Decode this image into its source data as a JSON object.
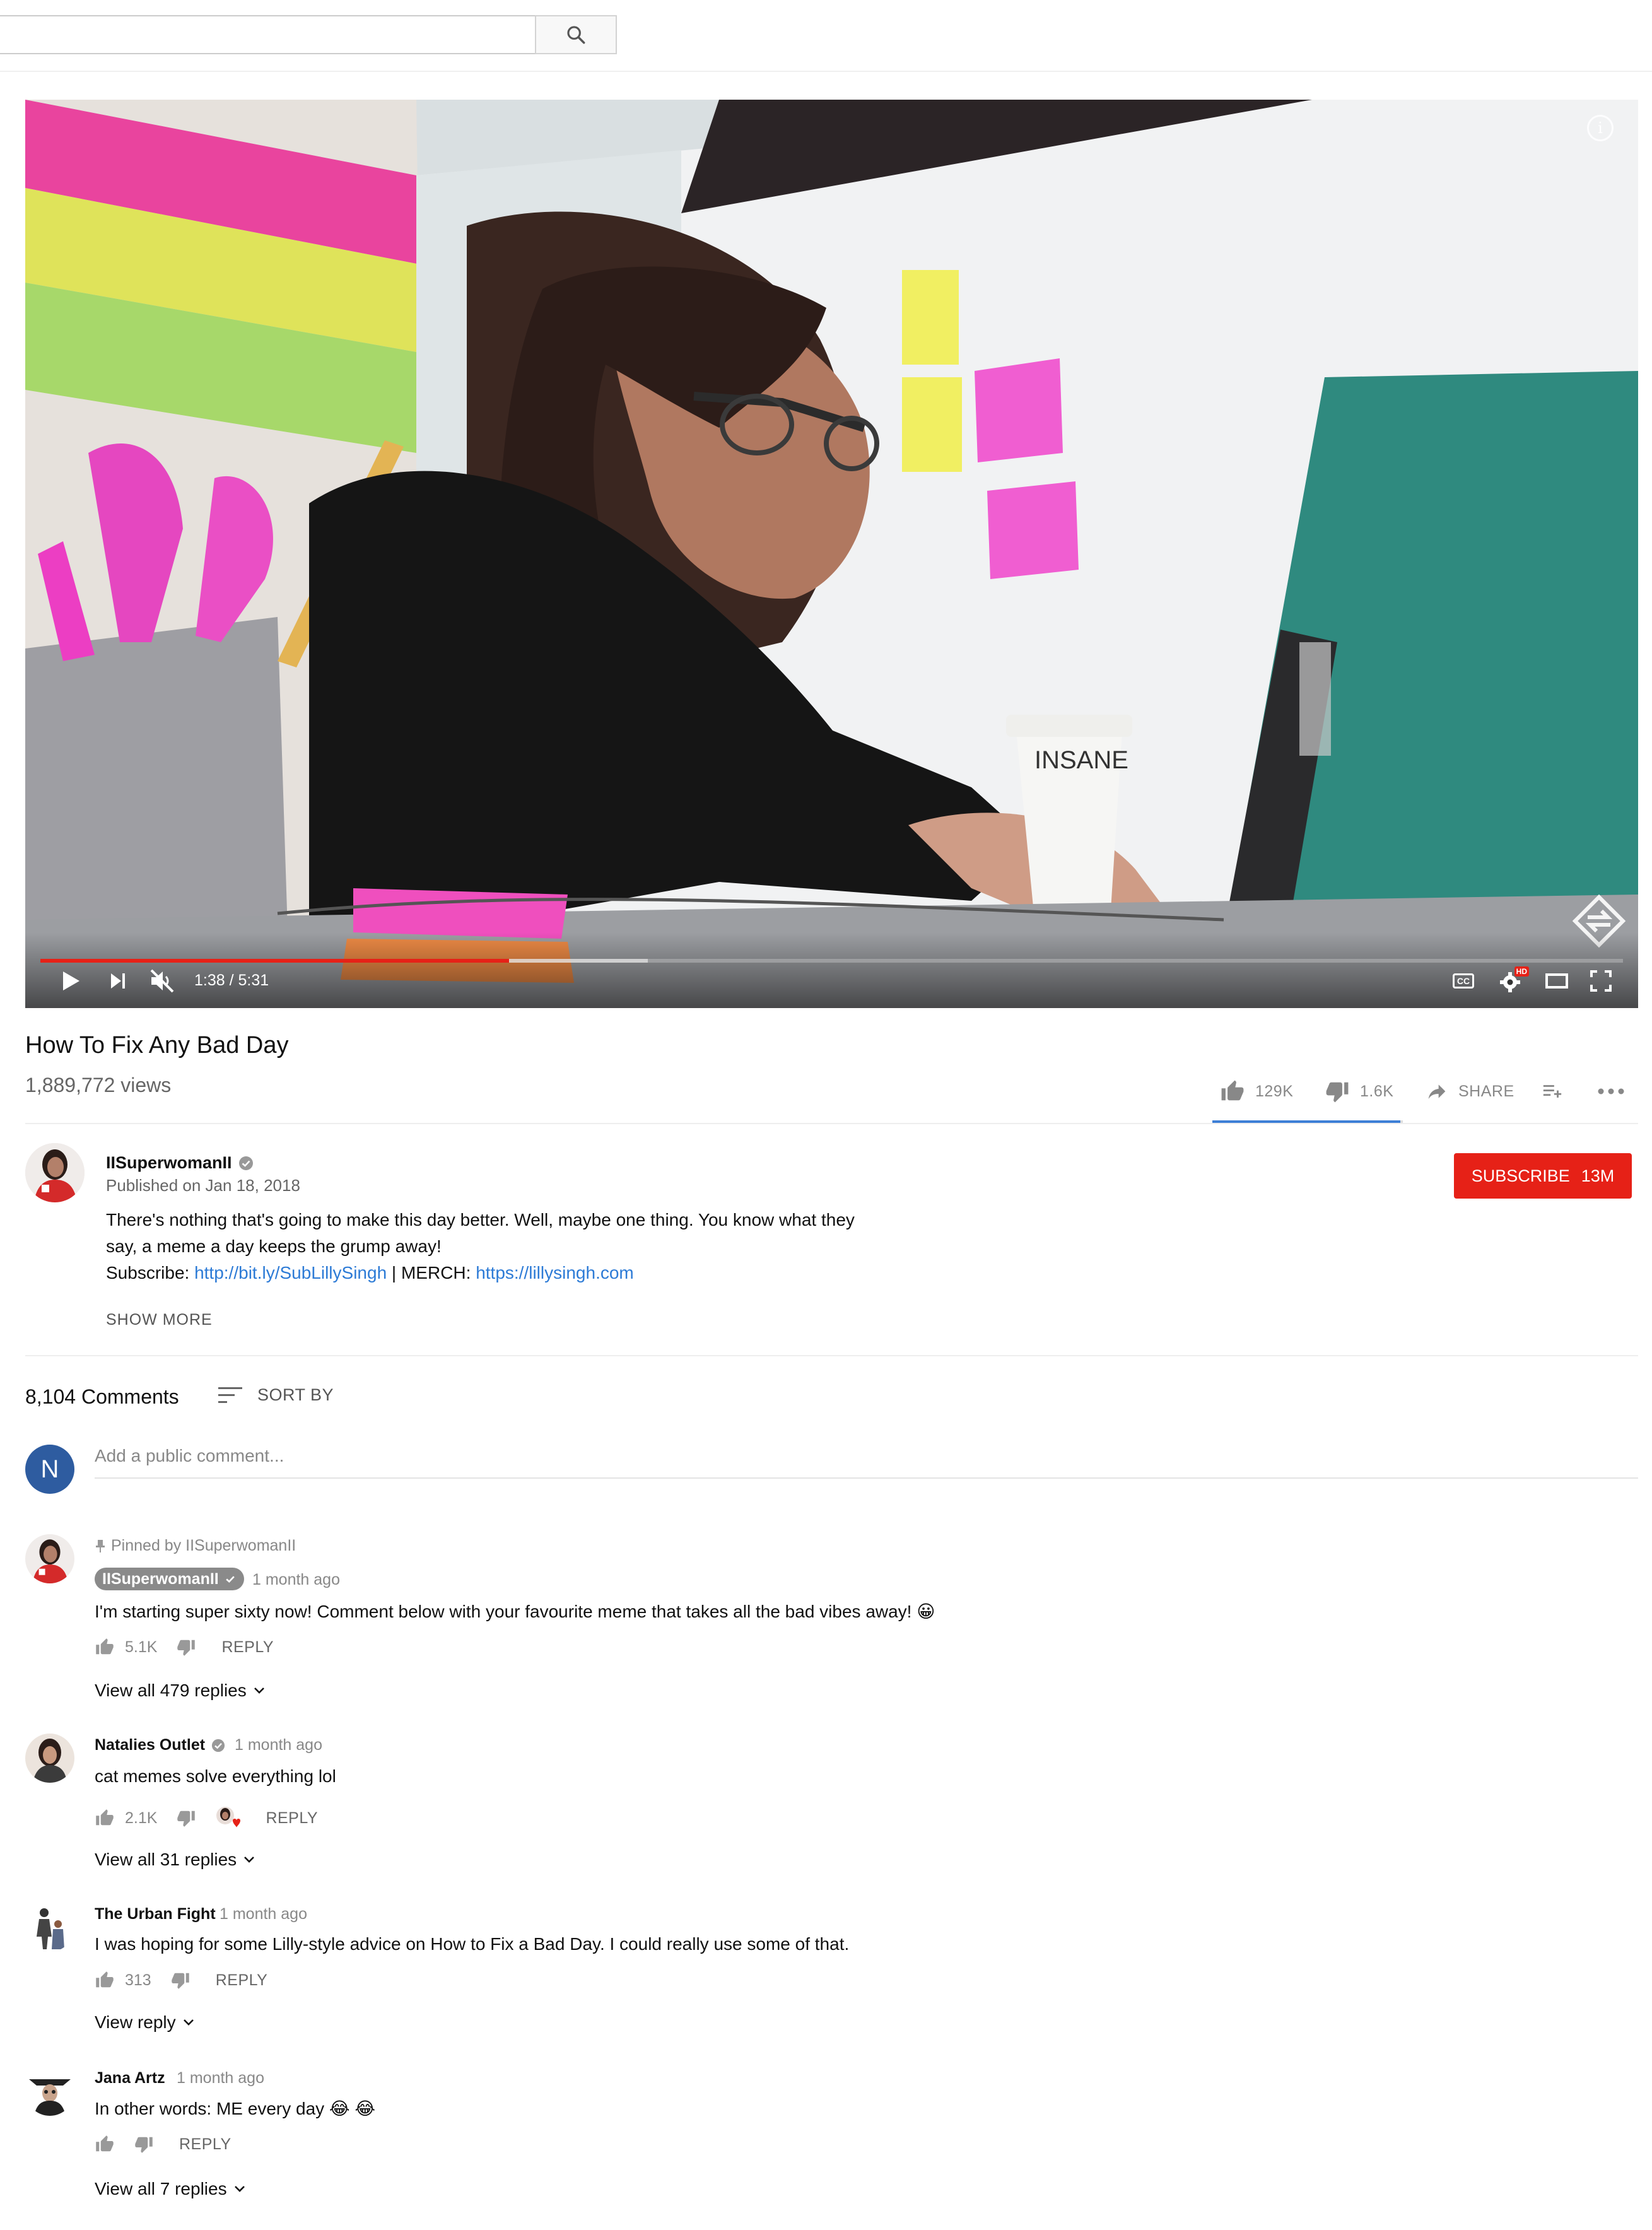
{
  "search": {
    "placeholder": "",
    "value": ""
  },
  "player": {
    "current_time": "1:38",
    "duration": "5:31",
    "time_display": "1:38 / 5:31",
    "progress_fraction": 0.296,
    "buffered_fraction": 0.384,
    "cup_label": "INSANE",
    "hd_badge": "HD",
    "cc_label": "CC"
  },
  "video": {
    "title": "How To Fix Any Bad Day",
    "views": "1,889,772 views",
    "likes": "129K",
    "dislikes": "1.6K",
    "like_fraction": 0.988,
    "share_label": "SHARE"
  },
  "channel": {
    "name": "IISuperwomanII",
    "published": "Published on Jan 18, 2018",
    "subscribe_label": "SUBSCRIBE",
    "subscriber_count": "13M"
  },
  "description": {
    "line1": "There's nothing that's going to make this day better. Well, maybe one thing. You know what they",
    "line2": "say, a meme a day keeps the grump away!",
    "subscribe_prefix": "Subscribe: ",
    "subscribe_link": "http://bit.ly/SubLillySingh",
    "merch_prefix": " | MERCH: ",
    "merch_link": "https://lillysingh.com",
    "show_more": "SHOW MORE"
  },
  "comments_header": {
    "count": "8,104 Comments",
    "sort_label": "SORT BY",
    "user_initial": "N",
    "input_placeholder": "Add a public comment..."
  },
  "comments": [
    {
      "pinned_label": "Pinned by IISuperwomanII",
      "author": "IISuperwomanII",
      "time": "1 month ago",
      "text": "I'm starting super sixty now! Comment below with your favourite meme that takes all the bad vibes away! 😀",
      "likes": "5.1K",
      "reply_label": "REPLY",
      "replies_label": "View all 479 replies"
    },
    {
      "author": "Natalies Outlet",
      "time": "1 month ago",
      "text": "cat memes solve everything lol",
      "likes": "2.1K",
      "reply_label": "REPLY",
      "replies_label": "View all 31 replies"
    },
    {
      "author": "The Urban Fight",
      "time": "1 month ago",
      "text": "I was hoping for some Lilly-style advice on How to Fix a Bad Day. I could really use some of that.",
      "likes": "313",
      "reply_label": "REPLY",
      "replies_label": "View reply"
    },
    {
      "author": "Jana Artz",
      "time": "1 month ago",
      "text": "In other words: ME every day 😂 😂",
      "likes": "",
      "reply_label": "REPLY",
      "replies_label": "View all 7 replies"
    }
  ],
  "colors": {
    "accent_red": "#e62117",
    "link_blue": "#2d7bd6",
    "sentiment_blue": "#3d7fd6",
    "user_avatar": "#2e5ca0"
  }
}
